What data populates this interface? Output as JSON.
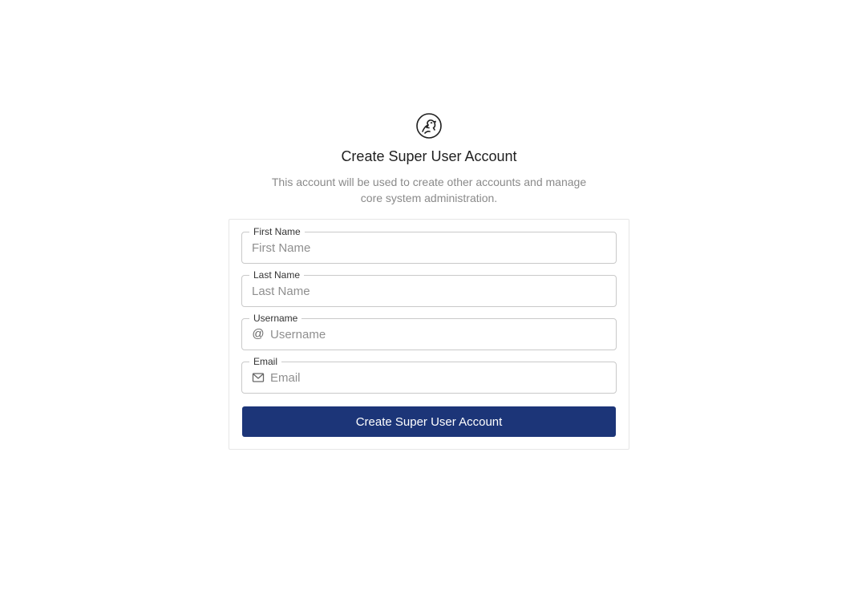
{
  "header": {
    "logo_icon": "dragon-logo-icon",
    "title": "Create Super User Account",
    "subtitle": "This account will be used to create other accounts and manage core system administration."
  },
  "form": {
    "first_name": {
      "label": "First Name",
      "placeholder": "First Name",
      "value": ""
    },
    "last_name": {
      "label": "Last Name",
      "placeholder": "Last Name",
      "value": ""
    },
    "username": {
      "label": "Username",
      "placeholder": "Username",
      "value": "",
      "adornment": "@"
    },
    "email": {
      "label": "Email",
      "placeholder": "Email",
      "value": "",
      "icon": "mail-icon"
    },
    "submit_label": "Create Super User Account"
  },
  "colors": {
    "primary": "#1c3578",
    "border": "#c9c9c9",
    "subtitle": "#8a8a8a"
  }
}
